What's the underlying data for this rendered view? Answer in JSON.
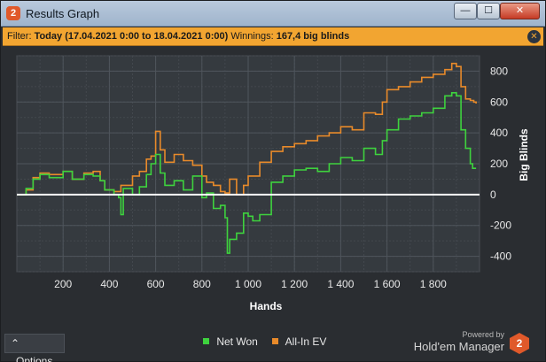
{
  "window": {
    "title": "Results Graph",
    "badge": "2"
  },
  "controls": {
    "minimize": "—",
    "maximize": "☐",
    "close": "✕"
  },
  "filter": {
    "label": "Filter:",
    "value": "Today (17.04.2021 0:00 to 18.04.2021 0:00)",
    "winnings_label": "Winnings:",
    "winnings_value": "167,4 big blinds",
    "close": "✕"
  },
  "options_label": "Options",
  "brand": {
    "powered": "Powered by",
    "name": "Hold'em Manager",
    "badge": "2"
  },
  "chart_data": {
    "type": "line",
    "xlabel": "Hands",
    "ylabel": "Big Blinds",
    "xlim": [
      0,
      2000
    ],
    "ylim": [
      -500,
      900
    ],
    "x_ticks": [
      200,
      400,
      600,
      800,
      1000,
      1200,
      1400,
      1600,
      1800
    ],
    "x_tick_labels": [
      "200",
      "400",
      "600",
      "800",
      "1 000",
      "1 200",
      "1 400",
      "1 600",
      "1 800"
    ],
    "y_ticks": [
      -400,
      -200,
      0,
      200,
      400,
      600,
      800
    ],
    "y_tick_labels": [
      "-400",
      "-200",
      "0",
      "200",
      "400",
      "600",
      "800"
    ],
    "grid": true,
    "legend_position": "bottom",
    "series": [
      {
        "name": "Net Won",
        "color": "#3ed23e",
        "x": [
          0,
          40,
          70,
          100,
          140,
          200,
          240,
          290,
          330,
          360,
          380,
          420,
          440,
          450,
          460,
          500,
          530,
          560,
          580,
          600,
          620,
          640,
          680,
          720,
          760,
          800,
          820,
          850,
          880,
          900,
          910,
          920,
          950,
          980,
          1000,
          1020,
          1050,
          1080,
          1100,
          1150,
          1200,
          1250,
          1300,
          1350,
          1400,
          1450,
          1500,
          1550,
          1580,
          1600,
          1650,
          1700,
          1750,
          1800,
          1850,
          1880,
          1900,
          1920,
          1940,
          1960,
          1970,
          1985
        ],
        "values": [
          0,
          40,
          100,
          130,
          110,
          150,
          100,
          130,
          120,
          90,
          30,
          0,
          -20,
          -130,
          40,
          0,
          50,
          130,
          200,
          260,
          140,
          60,
          90,
          30,
          120,
          -20,
          10,
          -90,
          -70,
          -150,
          -380,
          -290,
          -250,
          -120,
          -140,
          -170,
          -130,
          -130,
          80,
          120,
          160,
          170,
          150,
          200,
          240,
          220,
          300,
          260,
          350,
          420,
          490,
          510,
          530,
          560,
          640,
          660,
          640,
          420,
          300,
          200,
          170,
          170
        ]
      },
      {
        "name": "All-In EV",
        "color": "#e88a2a",
        "x": [
          0,
          40,
          70,
          100,
          140,
          200,
          240,
          290,
          330,
          360,
          380,
          420,
          450,
          500,
          530,
          560,
          580,
          600,
          620,
          640,
          680,
          720,
          760,
          800,
          820,
          850,
          880,
          900,
          920,
          950,
          980,
          1000,
          1050,
          1100,
          1150,
          1200,
          1250,
          1300,
          1350,
          1400,
          1450,
          1500,
          1550,
          1580,
          1600,
          1650,
          1700,
          1750,
          1800,
          1850,
          1880,
          1900,
          1920,
          1940,
          1960,
          1975,
          1985
        ],
        "values": [
          0,
          30,
          110,
          140,
          130,
          150,
          100,
          140,
          150,
          90,
          30,
          20,
          60,
          120,
          150,
          230,
          250,
          410,
          290,
          210,
          260,
          220,
          190,
          120,
          80,
          60,
          20,
          10,
          100,
          0,
          60,
          120,
          210,
          280,
          310,
          330,
          350,
          380,
          400,
          440,
          420,
          530,
          520,
          600,
          680,
          700,
          730,
          760,
          780,
          810,
          850,
          830,
          700,
          620,
          610,
          600,
          590
        ]
      }
    ],
    "baseline": {
      "y": 0,
      "color": "#ffffff"
    }
  }
}
